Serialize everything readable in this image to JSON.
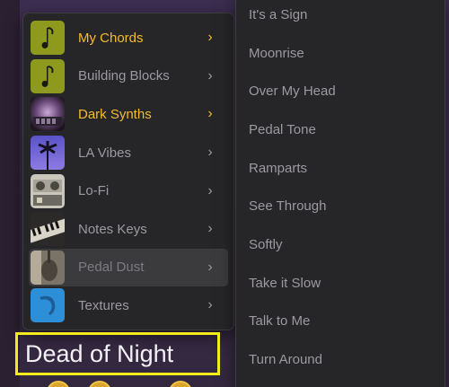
{
  "menu": {
    "items": [
      {
        "label": "My Chords",
        "state": "active",
        "thumb": "yellow-green-note"
      },
      {
        "label": "Building Blocks",
        "state": "normal",
        "thumb": "yellow-green-note"
      },
      {
        "label": "Dark Synths",
        "state": "active",
        "thumb": "purple-synth"
      },
      {
        "label": "LA Vibes",
        "state": "normal",
        "thumb": "palm-tree"
      },
      {
        "label": "Lo-Fi",
        "state": "normal",
        "thumb": "tape-machine"
      },
      {
        "label": "Notes Keys",
        "state": "normal",
        "thumb": "piano-keys"
      },
      {
        "label": "Pedal Dust",
        "state": "hovered",
        "thumb": "guitar"
      },
      {
        "label": "Textures",
        "state": "normal",
        "thumb": "blue-note"
      }
    ],
    "chevron": "›"
  },
  "submenu": {
    "items": [
      "It's a Sign",
      "Moonrise",
      "Over My Head",
      "Pedal Tone",
      "Ramparts",
      "See Through",
      "Softly",
      "Take it Slow",
      "Talk to Me",
      "Turn Around"
    ]
  },
  "title": "Dead of Night",
  "colors": {
    "accent": "#f4bd30",
    "menu_bg": "#262527",
    "text": "#9c9aa0",
    "highlight_box": "#f2ec1c"
  }
}
